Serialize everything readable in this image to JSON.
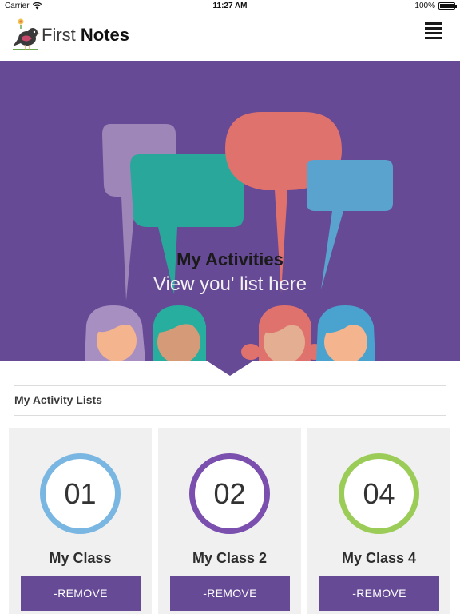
{
  "status_bar": {
    "carrier": "Carrier",
    "time": "11:27 AM",
    "battery": "100%"
  },
  "header": {
    "logo_word_light": "First",
    "logo_word_bold": "Notes"
  },
  "hero": {
    "title": "My Activities",
    "subtitle": "View you' list here"
  },
  "section": {
    "title": "My Activity Lists"
  },
  "lists": [
    {
      "number": "01",
      "name": "My Class",
      "ring_color": "#7ab6e2",
      "remove_label": "-REMOVE"
    },
    {
      "number": "02",
      "name": "My Class 2",
      "ring_color": "#7a4fae",
      "remove_label": "-REMOVE"
    },
    {
      "number": "04",
      "name": "My Class 4",
      "ring_color": "#9ccc58",
      "remove_label": "-REMOVE"
    }
  ],
  "colors": {
    "accent": "#674a96",
    "card_bg": "#f0f0f0"
  }
}
